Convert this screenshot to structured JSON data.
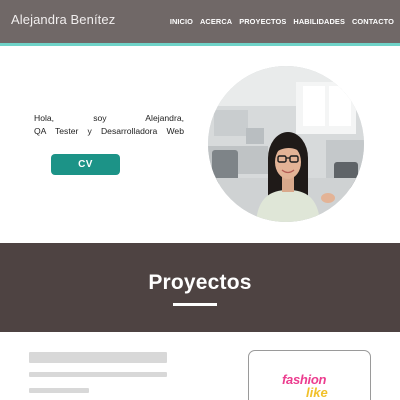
{
  "header": {
    "brand": "Alejandra Benítez",
    "nav": [
      "INICIO",
      "ACERCA",
      "PROYECTOS",
      "HABILIDADES",
      "CONTACTO"
    ]
  },
  "hero": {
    "greeting_line1": "Hola, soy Alejandra,",
    "greeting_line2": "QA Tester y Desarrolladora Web",
    "cv_button": "CV"
  },
  "projects": {
    "title": "Proyectos",
    "card_logo_line1": "fashion",
    "card_logo_line2": "like"
  },
  "colors": {
    "navbar": "#706867",
    "accent_line": "#6fd3c8",
    "button": "#1c9387",
    "banner": "#4e4342",
    "logo_pink": "#ec3d8f",
    "logo_yellow": "#f1c12b"
  },
  "icons": {
    "portrait": "profile-photo",
    "project_logo": "fashion-like-logo"
  }
}
